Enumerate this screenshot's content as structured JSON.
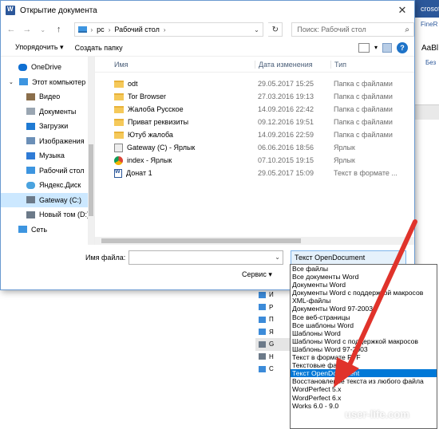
{
  "background": {
    "app_title": "crosoft",
    "ribbon_tab": "FineR",
    "style_name": "AaBl",
    "style_label": "Без"
  },
  "dialog": {
    "title": "Открытие документа",
    "address": {
      "root": "рс",
      "folder": "Рабочий стол"
    },
    "search_placeholder": "Поиск: Рабочий стол",
    "toolbar": {
      "organize": "Упорядочить ▾",
      "new_folder": "Создать папку"
    },
    "nav_items": [
      {
        "label": "OneDrive",
        "icon": "cloud-icon",
        "color": "#0f6fd2"
      },
      {
        "label": "Этот компьютер",
        "icon": "computer-icon",
        "color": "#3d95e0"
      },
      {
        "label": "Видео",
        "icon": "video-folder-icon",
        "color": "#8a6e4b"
      },
      {
        "label": "Документы",
        "icon": "documents-folder-icon",
        "color": "#9aa6b2"
      },
      {
        "label": "Загрузки",
        "icon": "downloads-folder-icon",
        "color": "#1f7ad3"
      },
      {
        "label": "Изображения",
        "icon": "pictures-folder-icon",
        "color": "#6b8fb7"
      },
      {
        "label": "Музыка",
        "icon": "music-folder-icon",
        "color": "#2f7bd6"
      },
      {
        "label": "Рабочий стол",
        "icon": "desktop-folder-icon",
        "color": "#3d95e0"
      },
      {
        "label": "Яндекс.Диск",
        "icon": "yandex-disk-icon",
        "color": "#4aa3df"
      },
      {
        "label": "Gateway (C:)",
        "icon": "drive-icon",
        "color": "#6c7a89"
      },
      {
        "label": "Новый том (D:)",
        "icon": "drive-icon",
        "color": "#6c7a89"
      },
      {
        "label": "Сеть",
        "icon": "network-icon",
        "color": "#3d95e0"
      }
    ],
    "columns": {
      "name": "Имя",
      "date": "Дата изменения",
      "type": "Тип"
    },
    "files": [
      {
        "name": "odt",
        "date": "29.05.2017 15:25",
        "type": "Папка с файлами",
        "icon": "folder-icon"
      },
      {
        "name": "Tor Browser",
        "date": "27.03.2016 19:13",
        "type": "Папка с файлами",
        "icon": "folder-icon"
      },
      {
        "name": "Жалоба Русское",
        "date": "14.09.2016 22:42",
        "type": "Папка с файлами",
        "icon": "folder-icon"
      },
      {
        "name": "Приват реквизиты",
        "date": "09.12.2016 19:51",
        "type": "Папка с файлами",
        "icon": "folder-icon"
      },
      {
        "name": "Ютуб жалоба",
        "date": "14.09.2016 22:59",
        "type": "Папка с файлами",
        "icon": "folder-icon"
      },
      {
        "name": "Gateway (C) - Ярлык",
        "date": "06.06.2016 18:56",
        "type": "Ярлык",
        "icon": "shortcut-icon"
      },
      {
        "name": "index - Ярлык",
        "date": "07.10.2015 19:15",
        "type": "Ярлык",
        "icon": "chrome-shortcut-icon"
      },
      {
        "name": "Донат 1",
        "date": "29.05.2017 15:09",
        "type": "Текст в формате ...",
        "icon": "word-document-icon"
      }
    ],
    "file_name_label": "Имя файла:",
    "file_name_value": "",
    "file_type_selected": "Текст OpenDocument",
    "service_label": "Сервис",
    "file_type_options": [
      "Все файлы",
      "Все документы Word",
      "Документы Word",
      "Документы Word с поддержкой макросов",
      "XML-файлы",
      "Документы Word 97-2003",
      "Все веб-страницы",
      "Все шаблоны Word",
      "Шаблоны Word",
      "Шаблоны Word с поддержкой макросов",
      "Шаблоны Word 97-2003",
      "Текст в формате RTF",
      "Текстовые файлы",
      "Текст OpenDocument",
      "Восстановление текста из любого файла",
      "WordPerfect 5.x",
      "WordPerfect 6.x",
      "Works 6.0 - 9.0"
    ],
    "selected_option_index": 13
  },
  "background_list": [
    "И",
    "Р",
    "П",
    "Я",
    "G",
    "Н",
    "С"
  ],
  "watermark": "user-life.com",
  "colors": {
    "accent": "#0078d7",
    "arrow": "#e0332b",
    "word_blue": "#2b579a"
  }
}
